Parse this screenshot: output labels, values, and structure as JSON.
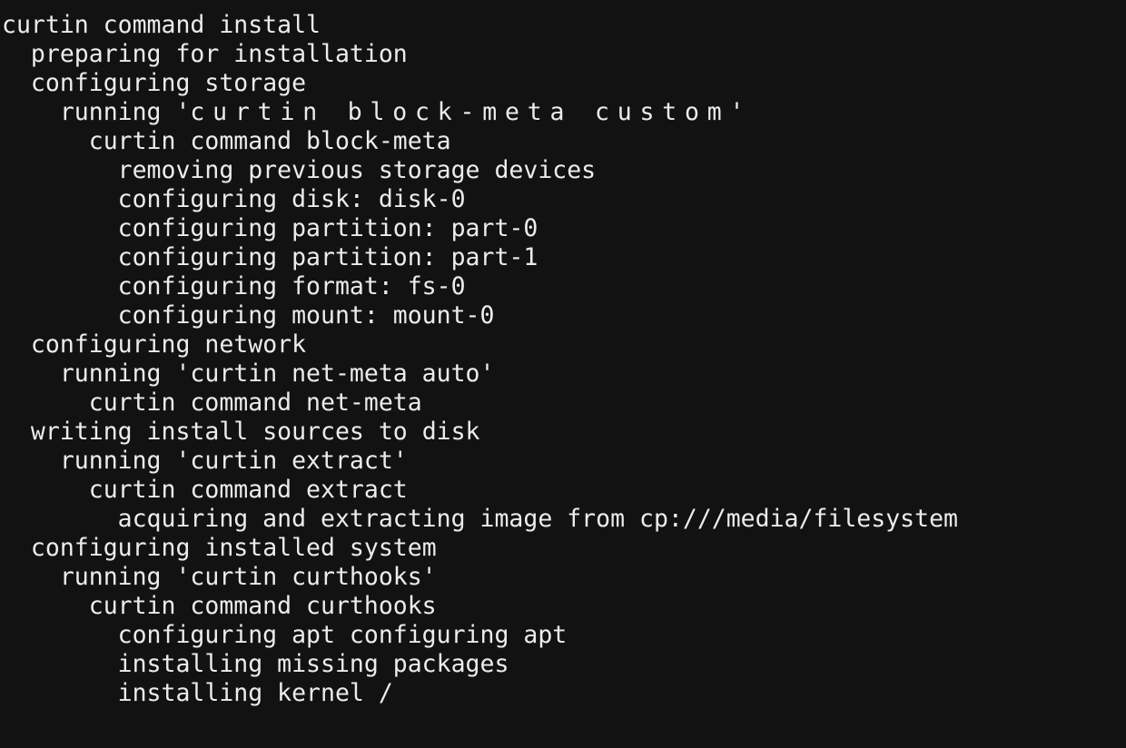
{
  "terminal": {
    "lines": [
      {
        "indent": 0,
        "text": "curtin command install"
      },
      {
        "indent": 1,
        "text": "preparing for installation"
      },
      {
        "indent": 1,
        "text": "configuring storage"
      },
      {
        "indent": 2,
        "prefix": "running '",
        "wide_text": "curtin block-meta custom",
        "suffix": "'"
      },
      {
        "indent": 3,
        "text": "curtin command block-meta"
      },
      {
        "indent": 4,
        "text": "removing previous storage devices"
      },
      {
        "indent": 4,
        "text": "configuring disk: disk-0"
      },
      {
        "indent": 4,
        "text": "configuring partition: part-0"
      },
      {
        "indent": 4,
        "text": "configuring partition: part-1"
      },
      {
        "indent": 4,
        "text": "configuring format: fs-0"
      },
      {
        "indent": 4,
        "text": "configuring mount: mount-0"
      },
      {
        "indent": 1,
        "text": "configuring network"
      },
      {
        "indent": 2,
        "text": "running 'curtin net-meta auto'"
      },
      {
        "indent": 3,
        "text": "curtin command net-meta"
      },
      {
        "indent": 1,
        "text": "writing install sources to disk"
      },
      {
        "indent": 2,
        "text": "running 'curtin extract'"
      },
      {
        "indent": 3,
        "text": "curtin command extract"
      },
      {
        "indent": 4,
        "text": "acquiring and extracting image from cp:///media/filesystem"
      },
      {
        "indent": 1,
        "text": "configuring installed system"
      },
      {
        "indent": 2,
        "text": "running 'curtin curthooks'"
      },
      {
        "indent": 3,
        "text": "curtin command curthooks"
      },
      {
        "indent": 4,
        "text": "configuring apt configuring apt"
      },
      {
        "indent": 4,
        "text": "installing missing packages"
      },
      {
        "indent": 4,
        "text": "installing kernel /"
      }
    ]
  },
  "colors": {
    "background": "#121212",
    "foreground": "#ececec"
  }
}
